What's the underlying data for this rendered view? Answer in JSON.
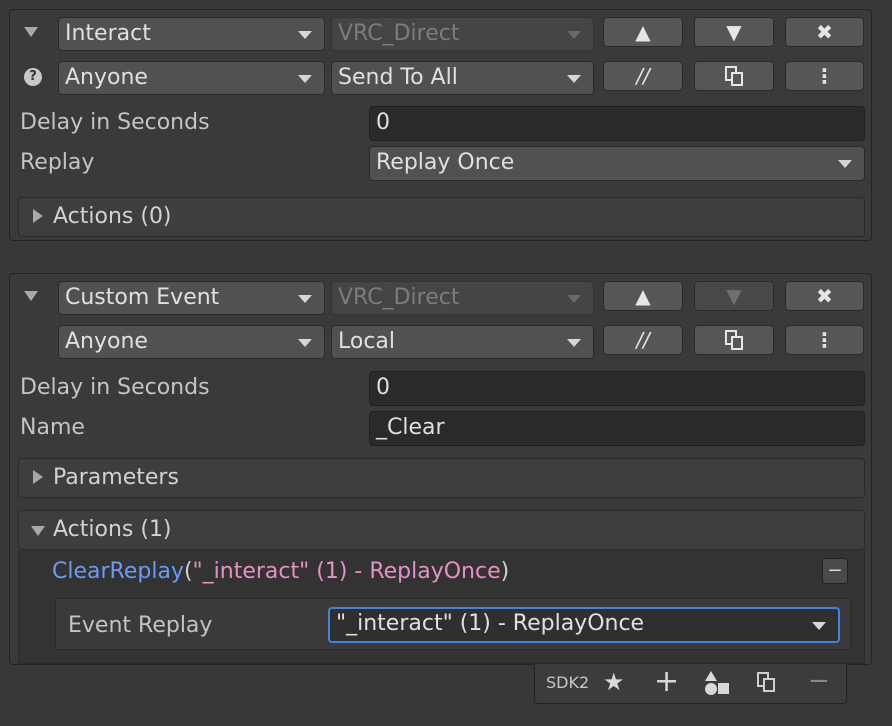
{
  "event1": {
    "trigger": "Interact",
    "broadcast_target": "VRC_Direct",
    "access": "Anyone",
    "send_mode": "Send To All",
    "delay_label": "Delay in Seconds",
    "delay_value": "0",
    "replay_label": "Replay",
    "replay_value": "Replay Once",
    "actions_foldout": "Actions (0)"
  },
  "event2": {
    "trigger": "Custom Event",
    "broadcast_target": "VRC_Direct",
    "access": "Anyone",
    "send_mode": "Local",
    "delay_label": "Delay in Seconds",
    "delay_value": "0",
    "name_label": "Name",
    "name_value": "_Clear",
    "parameters_foldout": "Parameters",
    "actions_foldout": "Actions (1)",
    "action": {
      "function": "ClearReplay",
      "open_paren": "(",
      "argument": "\"_interact\" (1) - ReplayOnce",
      "close_paren": ")",
      "event_replay_label": "Event Replay",
      "event_replay_value": "\"_interact\" (1) - ReplayOnce"
    }
  },
  "buttons": {
    "move_up": "▲",
    "move_down": "▼",
    "delete": "✖",
    "comment": "//",
    "menu": "⋮",
    "help": "?",
    "collapse": "▼",
    "remove_action": "−"
  },
  "toolbar": {
    "sdk_label": "SDK2",
    "favorite": "★",
    "add": "+",
    "remove": "−"
  },
  "colors": {
    "accent_focus": "#3f84e6",
    "function_name": "#6a9cf5",
    "string_argument": "#e88fc8"
  }
}
